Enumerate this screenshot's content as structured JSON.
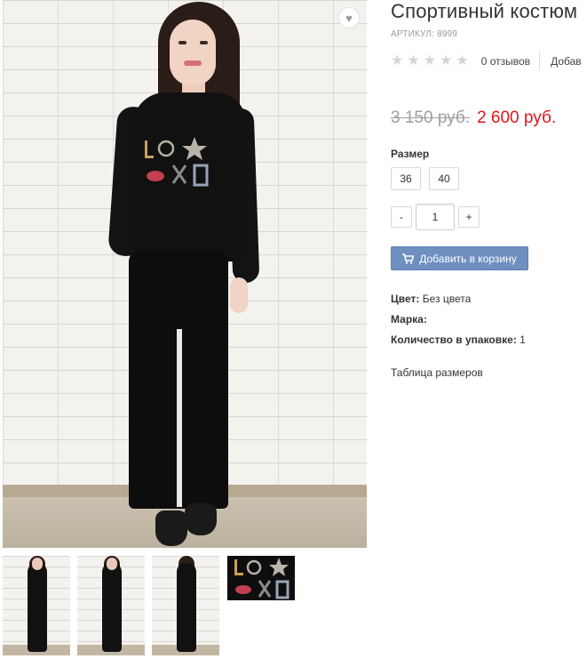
{
  "product": {
    "title": "Спортивный костюм",
    "sku_label": "АРТИКУЛ: 8999",
    "reviews_text": "0 отзывов",
    "add_review_text": "Добав",
    "old_price": "3 150 руб.",
    "new_price": "2 600 руб.",
    "size_label": "Размер",
    "sizes": [
      "36",
      "40"
    ],
    "quantity": "1",
    "qty_minus": "-",
    "qty_plus": "+",
    "add_to_cart_label": "Добавить в корзину",
    "properties": [
      {
        "label": "Цвет:",
        "value": "Без цвета"
      },
      {
        "label": "Марка:",
        "value": ""
      },
      {
        "label": "Количество в упаковке:",
        "value": "1"
      }
    ],
    "size_table_link": "Таблица размеров",
    "rating_stars_filled": 0,
    "rating_stars_total": 5
  },
  "icons": {
    "wishlist": "heart-icon",
    "cart": "cart-icon",
    "star": "star-icon"
  },
  "colors": {
    "new_price": "#e2141a",
    "old_price": "#9e9e9e",
    "cart_button": "#6f8fc0",
    "star_empty": "#d4d4d4"
  }
}
